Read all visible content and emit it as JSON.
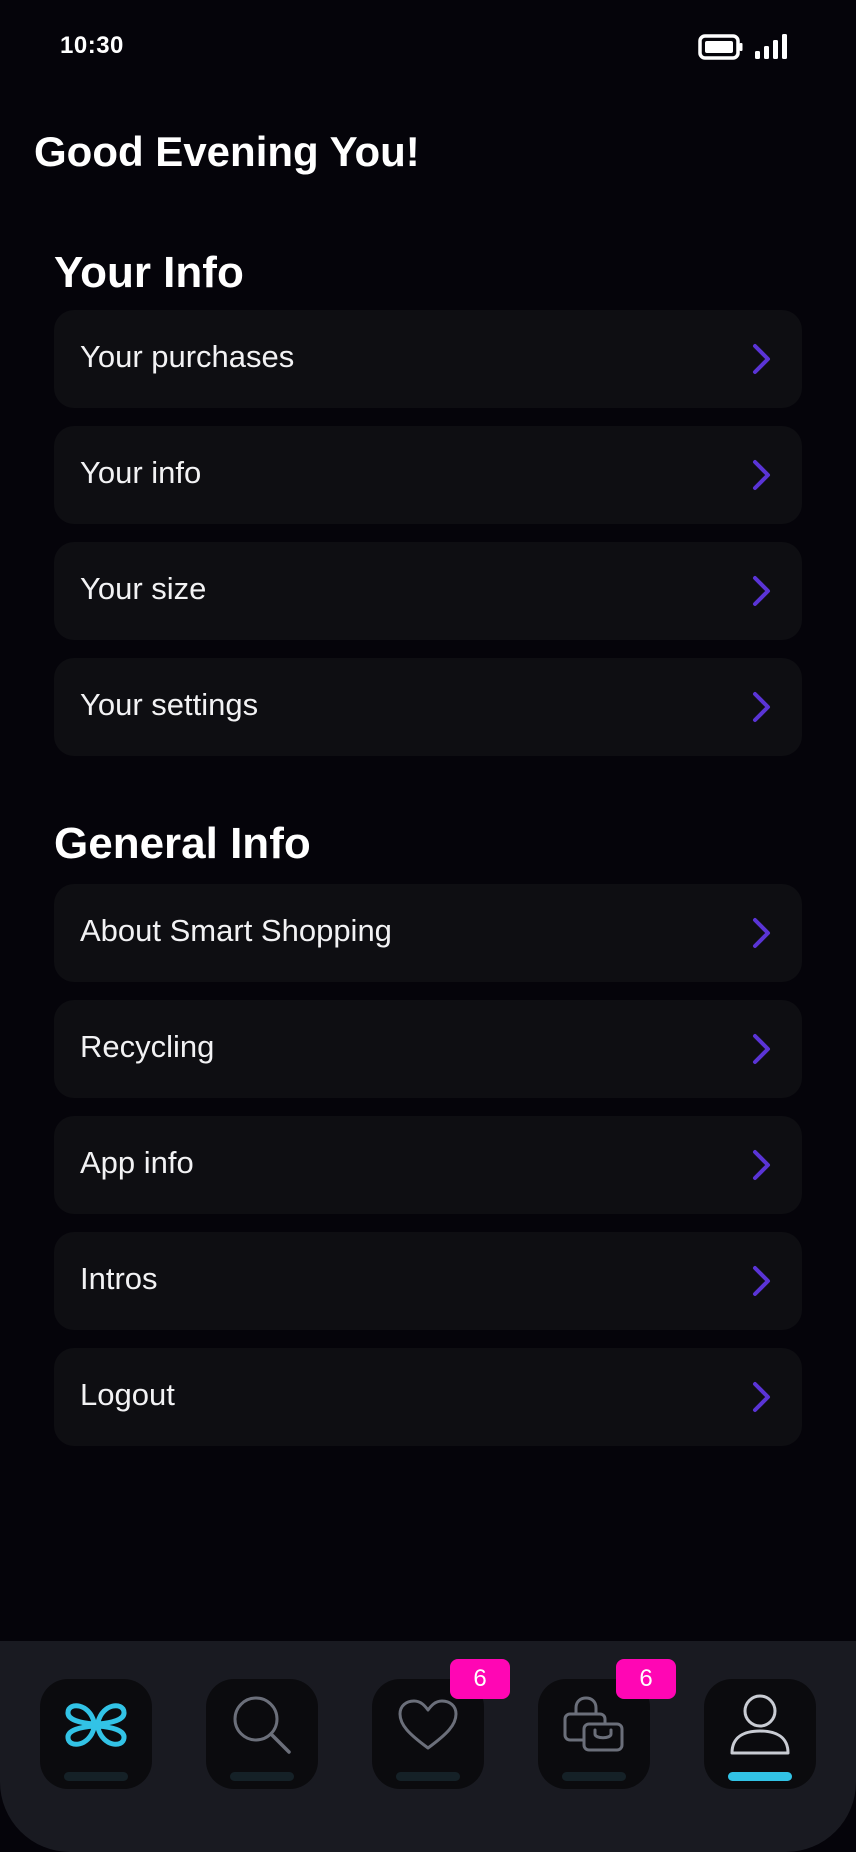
{
  "status_bar": {
    "time": "10:30",
    "battery_icon": "battery-full-icon",
    "signal_icon": "signal-bars-icon"
  },
  "greeting": "Good Evening You!",
  "sections": {
    "your_info": {
      "title": "Your Info",
      "items": [
        {
          "label": "Your purchases"
        },
        {
          "label": "Your info"
        },
        {
          "label": "Your size"
        },
        {
          "label": "Your settings"
        }
      ]
    },
    "general_info": {
      "title": "General Info",
      "items": [
        {
          "label": "About Smart Shopping"
        },
        {
          "label": "Recycling"
        },
        {
          "label": "App info"
        },
        {
          "label": "Intros"
        },
        {
          "label": "Logout"
        }
      ]
    }
  },
  "bottom_nav": {
    "items": [
      {
        "icon": "smart-shopping-logo-icon",
        "active": false
      },
      {
        "icon": "search-icon",
        "active": false
      },
      {
        "icon": "heart-icon",
        "badge": "6",
        "active": false
      },
      {
        "icon": "shopping-bag-icon",
        "badge": "6",
        "active": false
      },
      {
        "icon": "profile-icon",
        "active": true
      }
    ]
  },
  "colors": {
    "background": "#05040a",
    "card": "#0e0e12",
    "chevron": "#5a34d6",
    "accent": "#32c3e6",
    "badge": "#ff06b4",
    "nav_bar": "#191a21"
  }
}
